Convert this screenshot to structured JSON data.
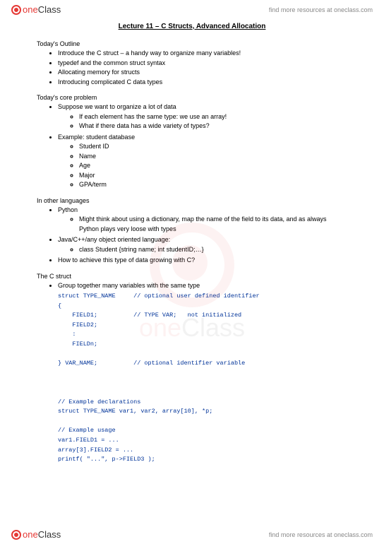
{
  "brand": {
    "name_part1": "one",
    "name_part2": "Class",
    "tagline": "find more resources at oneclass.com"
  },
  "title": "Lecture 11 – C Structs, Advanced Allocation",
  "sections": {
    "outline": {
      "header": "Today's Outline",
      "items": [
        "Introduce the C struct – a handy way to organize many variables!",
        "typedef and the common struct syntax",
        "Allocating memory for structs",
        "Introducing complicated C data types"
      ]
    },
    "core_problem": {
      "header": "Today's core problem",
      "items": [
        {
          "text": "Suppose we want to organize a lot of data",
          "sub": [
            "If each element has the same type: we use an array!",
            "What if there data has a wide variety of types?"
          ]
        },
        {
          "text": "Example: student database",
          "sub": [
            "Student ID",
            "Name",
            "Age",
            "Major",
            "GPA/term"
          ]
        }
      ]
    },
    "other_langs": {
      "header": "In other languages",
      "items": [
        {
          "text": "Python",
          "sub": [
            "Might think about using a dictionary, map the name of the field to its data, and as always Python plays very loose with types"
          ]
        },
        {
          "text": "Java/C++/any object oriented language:",
          "sub": [
            "class Student {string name; int studentID;…}"
          ]
        },
        {
          "text": "How to achieve this type of data growing with C?",
          "sub": []
        }
      ]
    },
    "c_struct": {
      "header": "The C struct",
      "items": [
        "Group together many variables with the same type"
      ],
      "code": "struct TYPE_NAME     // optional user defined identifier\n{\n    FIELD1;          // TYPE VAR;   not initialized\n    FIELD2;\n    :\n    FIELDn;\n\n} VAR_NAME;          // optional identifier variable\n\n\n\n// Example declarations\nstruct TYPE_NAME var1, var2, array[10], *p;\n\n// Example usage\nvar1.FIELD1 = ...\narray[3].FIELD2 = ...\nprintf( \"...\", p->FIELD3 );"
    }
  }
}
